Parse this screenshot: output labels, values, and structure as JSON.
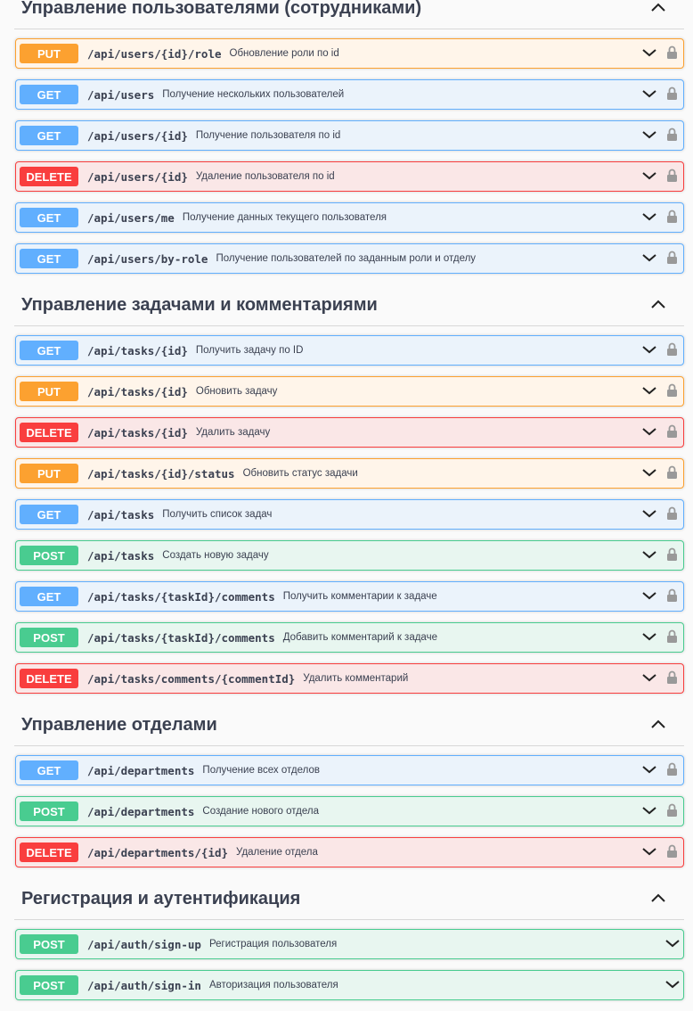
{
  "sections": [
    {
      "title": "Управление пользователями (сотрудниками)",
      "operations": [
        {
          "method": "PUT",
          "path": "/api/users/{id}/role",
          "summary": "Обновление роли по id",
          "locked": true
        },
        {
          "method": "GET",
          "path": "/api/users",
          "summary": "Получение нескольких пользователей",
          "locked": true
        },
        {
          "method": "GET",
          "path": "/api/users/{id}",
          "summary": "Получение пользователя по id",
          "locked": true
        },
        {
          "method": "DELETE",
          "path": "/api/users/{id}",
          "summary": "Удаление пользователя по id",
          "locked": true
        },
        {
          "method": "GET",
          "path": "/api/users/me",
          "summary": "Получение данных текущего пользователя",
          "locked": true
        },
        {
          "method": "GET",
          "path": "/api/users/by-role",
          "summary": "Получение пользователей по заданным роли и отделу",
          "locked": true
        }
      ]
    },
    {
      "title": "Управление задачами и комментариями",
      "operations": [
        {
          "method": "GET",
          "path": "/api/tasks/{id}",
          "summary": "Получить задачу по ID",
          "locked": true
        },
        {
          "method": "PUT",
          "path": "/api/tasks/{id}",
          "summary": "Обновить задачу",
          "locked": true
        },
        {
          "method": "DELETE",
          "path": "/api/tasks/{id}",
          "summary": "Удалить задачу",
          "locked": true
        },
        {
          "method": "PUT",
          "path": "/api/tasks/{id}/status",
          "summary": "Обновить статус задачи",
          "locked": true
        },
        {
          "method": "GET",
          "path": "/api/tasks",
          "summary": "Получить список задач",
          "locked": true
        },
        {
          "method": "POST",
          "path": "/api/tasks",
          "summary": "Создать новую задачу",
          "locked": true
        },
        {
          "method": "GET",
          "path": "/api/tasks/{taskId}/comments",
          "summary": "Получить комментарии к задаче",
          "locked": true
        },
        {
          "method": "POST",
          "path": "/api/tasks/{taskId}/comments",
          "summary": "Добавить комментарий к задаче",
          "locked": true
        },
        {
          "method": "DELETE",
          "path": "/api/tasks/comments/{commentId}",
          "summary": "Удалить комментарий",
          "locked": true
        }
      ]
    },
    {
      "title": "Управление отделами",
      "operations": [
        {
          "method": "GET",
          "path": "/api/departments",
          "summary": "Получение всех отделов",
          "locked": true
        },
        {
          "method": "POST",
          "path": "/api/departments",
          "summary": "Создание нового отдела",
          "locked": true
        },
        {
          "method": "DELETE",
          "path": "/api/departments/{id}",
          "summary": "Удаление отдела",
          "locked": true
        }
      ]
    },
    {
      "title": "Регистрация и аутентификация",
      "operations": [
        {
          "method": "POST",
          "path": "/api/auth/sign-up",
          "summary": "Регистрация пользователя",
          "locked": false
        },
        {
          "method": "POST",
          "path": "/api/auth/sign-in",
          "summary": "Авторизация пользователя",
          "locked": false
        }
      ]
    }
  ],
  "colors": {
    "get": "#61affe",
    "put": "#fca130",
    "post": "#49cc90",
    "delete": "#f93e3e",
    "text": "#3b4151"
  },
  "icons": {
    "collapse": "chevron-up-icon",
    "expand": "chevron-down-icon",
    "lock": "lock-icon"
  }
}
